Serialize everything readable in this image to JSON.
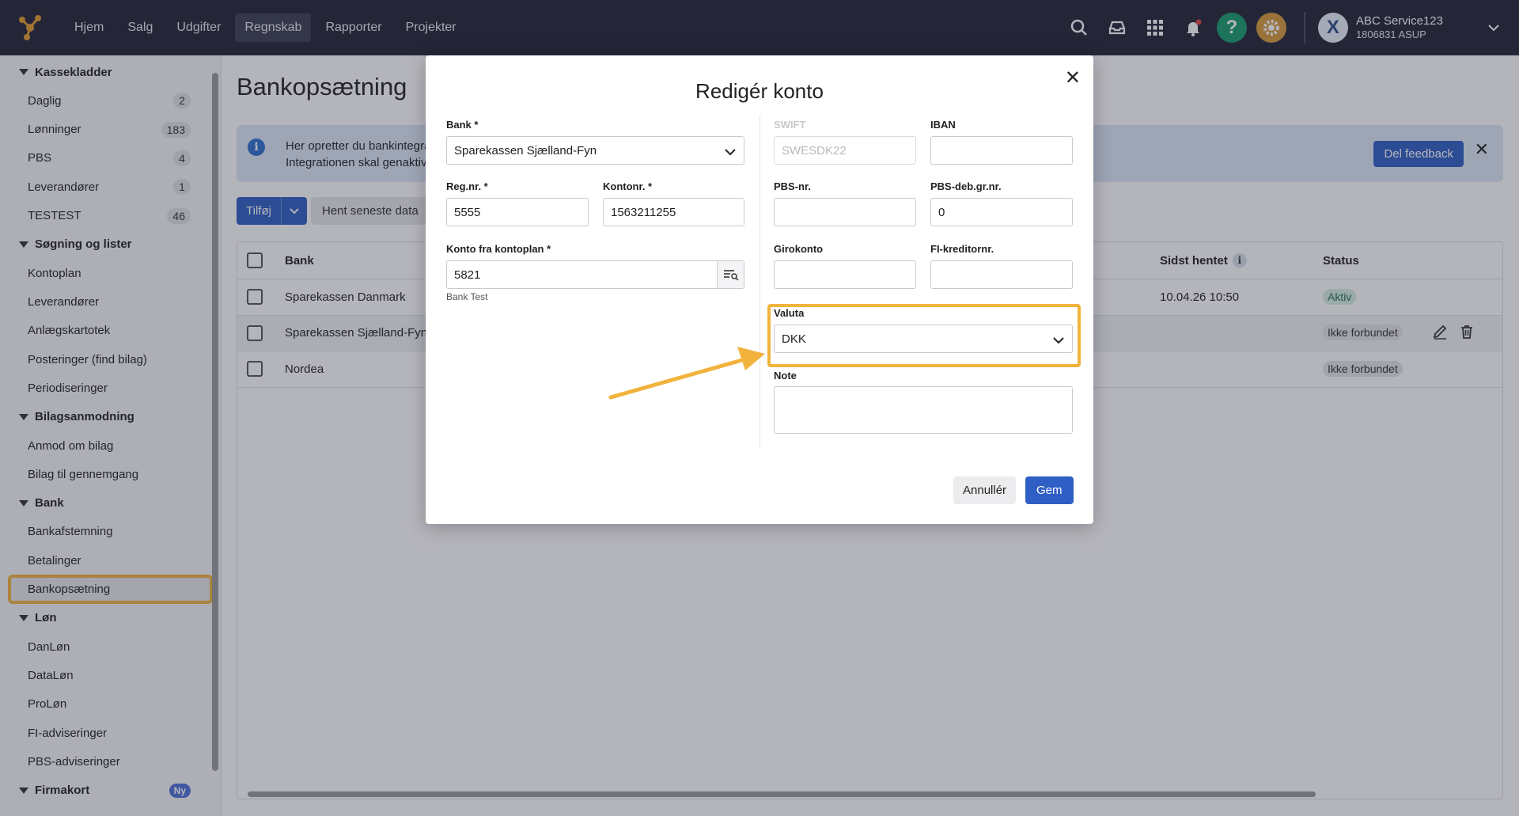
{
  "nav": {
    "items": [
      {
        "label": "Hjem"
      },
      {
        "label": "Salg"
      },
      {
        "label": "Udgifter"
      },
      {
        "label": "Regnskab"
      },
      {
        "label": "Rapporter"
      },
      {
        "label": "Projekter"
      }
    ],
    "active": "Regnskab"
  },
  "account": {
    "name": "ABC Service123",
    "sub": "1806831 ASUP",
    "avatar_letter": "X"
  },
  "top_icons": [
    "search-icon",
    "inbox-icon",
    "apps-grid-icon",
    "bell-icon",
    "help-icon",
    "settings-icon"
  ],
  "sidebar": {
    "groups": [
      {
        "label": "Kassekladder",
        "items": [
          {
            "label": "Daglig",
            "badge": "2"
          },
          {
            "label": "Lønninger",
            "badge": "183"
          },
          {
            "label": "PBS",
            "badge": "4"
          },
          {
            "label": "Leverandører",
            "badge": "1"
          },
          {
            "label": "TESTEST",
            "badge": "46"
          }
        ]
      },
      {
        "label": "Søgning og lister",
        "items": [
          {
            "label": "Kontoplan"
          },
          {
            "label": "Leverandører"
          },
          {
            "label": "Anlægskartotek"
          },
          {
            "label": "Posteringer (find bilag)"
          },
          {
            "label": "Periodiseringer"
          }
        ]
      },
      {
        "label": "Bilagsanmodning",
        "items": [
          {
            "label": "Anmod om bilag"
          },
          {
            "label": "Bilag til gennemgang"
          }
        ]
      },
      {
        "label": "Bank",
        "items": [
          {
            "label": "Bankafstemning"
          },
          {
            "label": "Betalinger"
          },
          {
            "label": "Bankopsætning",
            "selected": true
          }
        ]
      },
      {
        "label": "Løn",
        "items": [
          {
            "label": "DanLøn"
          },
          {
            "label": "DataLøn"
          },
          {
            "label": "ProLøn"
          },
          {
            "label": "FI-adviseringer"
          },
          {
            "label": "PBS-adviseringer"
          }
        ]
      }
    ],
    "last_group": {
      "label": "Firmakort",
      "badge": "Ny"
    }
  },
  "main": {
    "title": "Bankopsætning",
    "info_line1": "Her opretter du bankintegrati",
    "info_line2": "Integrationen skal genaktiver",
    "feedback_label": "Del feedback",
    "add_label": "Tilføj",
    "fetch_label": "Hent seneste data",
    "table": {
      "headers": {
        "bank": "Bank",
        "last_fetched": "Sidst hentet",
        "status": "Status"
      },
      "rows": [
        {
          "bank": "Sparekassen Danmark",
          "last_fetched": "10.04.26 10:50",
          "status": "Aktiv"
        },
        {
          "bank": "Sparekassen Sjælland-Fyn",
          "last_fetched": "",
          "status": "Ikke forbundet"
        },
        {
          "bank": "Nordea",
          "last_fetched": "",
          "status": "Ikke forbundet"
        }
      ]
    }
  },
  "modal": {
    "title": "Redigér konto",
    "bank_label": "Bank *",
    "bank_value": "Sparekassen Sjælland-Fyn",
    "regnr_label": "Reg.nr. *",
    "regnr_value": "5555",
    "kontonr_label": "Kontonr. *",
    "kontonr_value": "1563211255",
    "kontoplan_label": "Konto fra kontoplan *",
    "kontoplan_value": "5821",
    "kontoplan_hint": "Bank Test",
    "swift_label": "SWIFT",
    "swift_placeholder": "SWESDK22",
    "iban_label": "IBAN",
    "iban_value": "",
    "pbsnr_label": "PBS-nr.",
    "pbsnr_value": "",
    "pbsdeb_label": "PBS-deb.gr.nr.",
    "pbsdeb_value": "0",
    "girokonto_label": "Girokonto",
    "girokonto_value": "",
    "fikreditor_label": "FI-kreditornr.",
    "fikreditor_value": "",
    "valuta_label": "Valuta",
    "valuta_value": "DKK",
    "note_label": "Note",
    "note_value": "",
    "cancel_label": "Annullér",
    "save_label": "Gem"
  },
  "colors": {
    "topbar": "#222436",
    "primary": "#2f5fc4",
    "highlight": "#f2b33d",
    "help": "#1a9b6c",
    "settings": "#d89a3a"
  }
}
